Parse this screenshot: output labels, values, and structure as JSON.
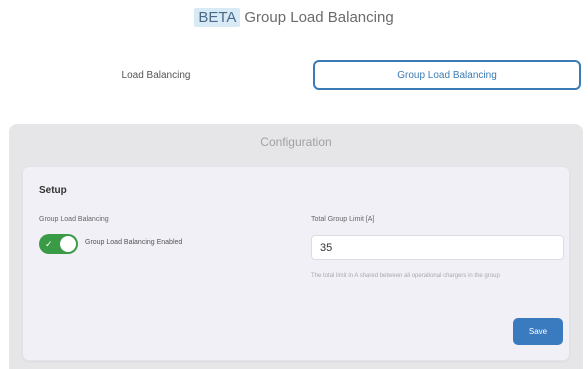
{
  "header": {
    "badge": "BETA",
    "title": "Group Load Balancing"
  },
  "tabs": [
    {
      "label": "Load Balancing",
      "active": false
    },
    {
      "label": "Group Load Balancing",
      "active": true
    }
  ],
  "configuration": {
    "title": "Configuration",
    "setup": {
      "title": "Setup",
      "group_load_balancing_label": "Group Load Balancing",
      "toggle": {
        "enabled": true,
        "label": "Group Load Balancing Enabled"
      },
      "total_group_limit": {
        "label": "Total Group Limit [A]",
        "value": "35",
        "help": "The total limit in A shared between all operational chargers in the group"
      },
      "save_label": "Save"
    }
  },
  "colors": {
    "accent": "#3a7bb5",
    "toggle_on": "#3a9b47",
    "badge_bg": "#d9eaf7",
    "panel_bg": "#e6e6e8",
    "card_bg": "#f1f0f7"
  }
}
